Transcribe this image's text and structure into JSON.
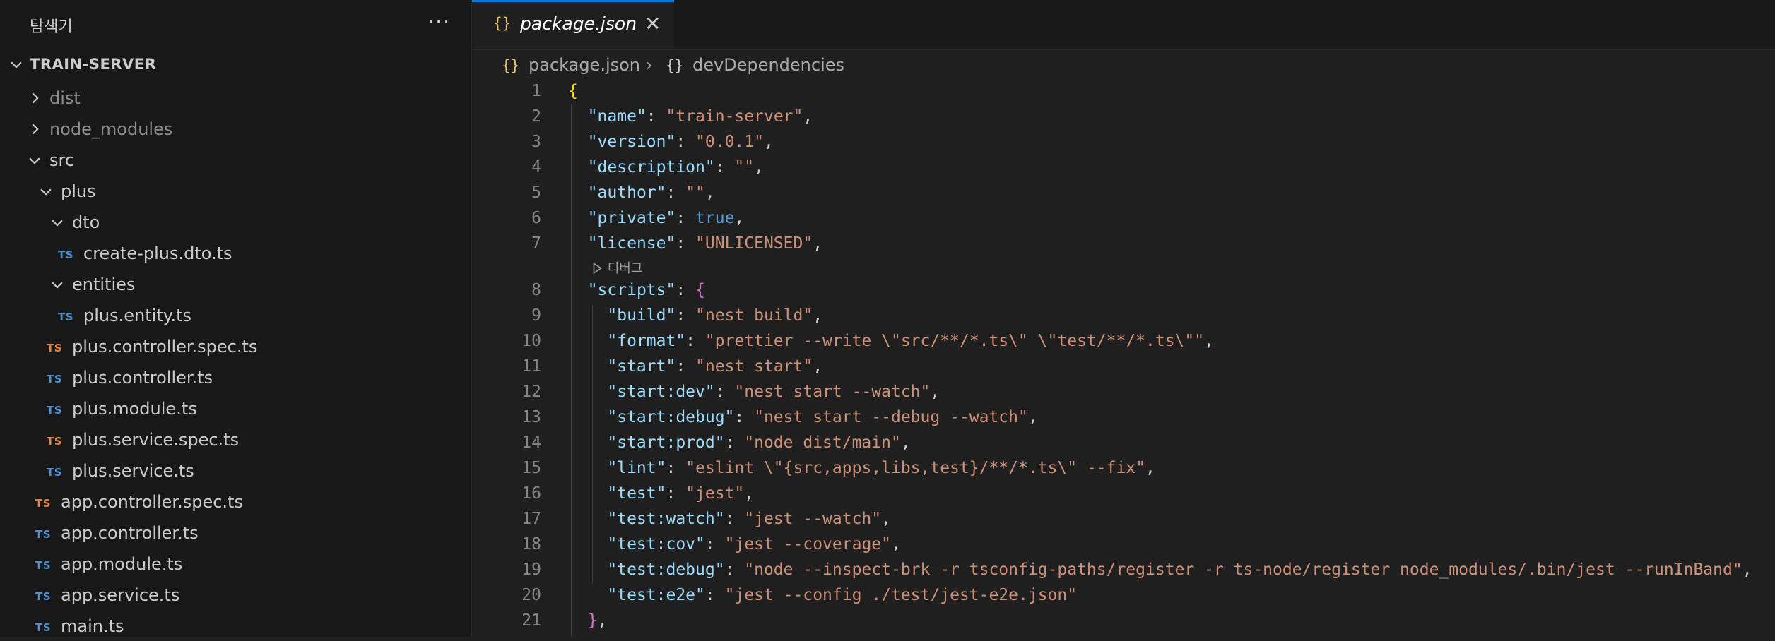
{
  "sidebar": {
    "title": "탐색기",
    "more_actions": "···",
    "project": "TRAIN-SERVER",
    "items": [
      {
        "label": "dist",
        "kind": "folder",
        "expanded": false,
        "dim": true
      },
      {
        "label": "node_modules",
        "kind": "folder",
        "expanded": false,
        "dim": true
      },
      {
        "label": "src",
        "kind": "folder",
        "expanded": true
      },
      {
        "label": "plus",
        "kind": "folder",
        "expanded": true
      },
      {
        "label": "dto",
        "kind": "folder",
        "expanded": true
      },
      {
        "label": "create-plus.dto.ts",
        "kind": "ts",
        "color": "blue",
        "badge": "TS"
      },
      {
        "label": "entities",
        "kind": "folder",
        "expanded": true
      },
      {
        "label": "plus.entity.ts",
        "kind": "ts",
        "color": "blue",
        "badge": "TS"
      },
      {
        "label": "plus.controller.spec.ts",
        "kind": "ts",
        "color": "orange",
        "badge": "TS"
      },
      {
        "label": "plus.controller.ts",
        "kind": "ts",
        "color": "blue",
        "badge": "TS"
      },
      {
        "label": "plus.module.ts",
        "kind": "ts",
        "color": "blue",
        "badge": "TS"
      },
      {
        "label": "plus.service.spec.ts",
        "kind": "ts",
        "color": "orange",
        "badge": "TS"
      },
      {
        "label": "plus.service.ts",
        "kind": "ts",
        "color": "blue",
        "badge": "TS"
      },
      {
        "label": "app.controller.spec.ts",
        "kind": "ts",
        "color": "orange",
        "badge": "TS"
      },
      {
        "label": "app.controller.ts",
        "kind": "ts",
        "color": "blue",
        "badge": "TS"
      },
      {
        "label": "app.module.ts",
        "kind": "ts",
        "color": "blue",
        "badge": "TS"
      },
      {
        "label": "app.service.ts",
        "kind": "ts",
        "color": "blue",
        "badge": "TS"
      },
      {
        "label": "main.ts",
        "kind": "ts",
        "color": "blue",
        "badge": "TS"
      }
    ]
  },
  "editor": {
    "tab": {
      "icon": "{}",
      "label": "package.json",
      "close": "✕"
    },
    "breadcrumb": {
      "file_icon": "{}",
      "file": "package.json",
      "separator": "›",
      "symbol_icon": "{}",
      "symbol": "devDependencies"
    },
    "codelens": "디버그",
    "lines": [
      {
        "n": "1",
        "key": "",
        "val": "",
        "open": "{",
        "type": "brace"
      },
      {
        "n": "2",
        "key": "\"name\"",
        "val": "\"train-server\"",
        "comma": true
      },
      {
        "n": "3",
        "key": "\"version\"",
        "val": "\"0.0.1\"",
        "comma": true
      },
      {
        "n": "4",
        "key": "\"description\"",
        "val": "\"\"",
        "comma": true
      },
      {
        "n": "5",
        "key": "\"author\"",
        "val": "\"\"",
        "comma": true
      },
      {
        "n": "6",
        "key": "\"private\"",
        "val": "true",
        "comma": true,
        "bool": true
      },
      {
        "n": "7",
        "key": "\"license\"",
        "val": "\"UNLICENSED\"",
        "comma": true
      },
      {
        "n": "8",
        "key": "\"scripts\"",
        "val": "",
        "open": "{",
        "type": "nested"
      },
      {
        "n": "9",
        "key": "\"build\"",
        "val": "\"nest build\"",
        "comma": true,
        "deep": true
      },
      {
        "n": "10",
        "key": "\"format\"",
        "val": "\"prettier --write \\\"src/**/*.ts\\\" \\\"test/**/*.ts\\\"\"",
        "comma": true,
        "deep": true
      },
      {
        "n": "11",
        "key": "\"start\"",
        "val": "\"nest start\"",
        "comma": true,
        "deep": true
      },
      {
        "n": "12",
        "key": "\"start:dev\"",
        "val": "\"nest start --watch\"",
        "comma": true,
        "deep": true
      },
      {
        "n": "13",
        "key": "\"start:debug\"",
        "val": "\"nest start --debug --watch\"",
        "comma": true,
        "deep": true
      },
      {
        "n": "14",
        "key": "\"start:prod\"",
        "val": "\"node dist/main\"",
        "comma": true,
        "deep": true
      },
      {
        "n": "15",
        "key": "\"lint\"",
        "val": "\"eslint \\\"{src,apps,libs,test}/**/*.ts\\\" --fix\"",
        "comma": true,
        "deep": true
      },
      {
        "n": "16",
        "key": "\"test\"",
        "val": "\"jest\"",
        "comma": true,
        "deep": true
      },
      {
        "n": "17",
        "key": "\"test:watch\"",
        "val": "\"jest --watch\"",
        "comma": true,
        "deep": true
      },
      {
        "n": "18",
        "key": "\"test:cov\"",
        "val": "\"jest --coverage\"",
        "comma": true,
        "deep": true
      },
      {
        "n": "19",
        "key": "\"test:debug\"",
        "val": "\"node --inspect-brk -r tsconfig-paths/register -r ts-node/register node_modules/.bin/jest --runInBand\"",
        "comma": true,
        "deep": true
      },
      {
        "n": "20",
        "key": "\"test:e2e\"",
        "val": "\"jest --config ./test/jest-e2e.json\"",
        "comma": false,
        "deep": true
      },
      {
        "n": "21",
        "key": "",
        "val": "",
        "close": "},",
        "type": "close"
      }
    ]
  },
  "colors": {
    "key": "#9cdcfe",
    "string": "#ce9178",
    "boolean": "#569cd6",
    "brace_level1": "#ffd700",
    "brace_level2": "#da70d6",
    "ts_blue": "#4d8fd1",
    "ts_orange": "#e2823f",
    "accent": "#0078d4"
  }
}
